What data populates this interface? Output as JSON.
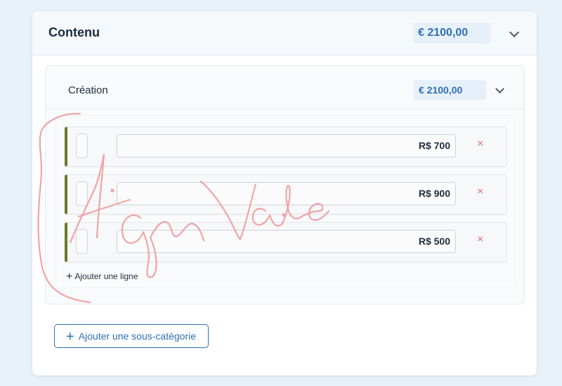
{
  "card": {
    "title": "Contenu",
    "total": "€ 2100,00",
    "chevron_icon": "chevron-down-icon"
  },
  "subcategory": {
    "title": "Création",
    "total": "€ 2100,00",
    "chevron_icon": "chevron-down-icon",
    "lines": [
      {
        "amount": "R$ 700",
        "remove_label": "×"
      },
      {
        "amount": "R$ 900",
        "remove_label": "×"
      },
      {
        "amount": "R$ 500",
        "remove_label": "×"
      }
    ],
    "add_line": {
      "icon": "plus-icon",
      "label": "Ajouter une ligne"
    }
  },
  "add_subcategory": {
    "icon": "plus-icon",
    "label": "Ajouter une sous-catégorie"
  },
  "signature": {
    "text": "Agne Vale",
    "color": "#ef9c9c"
  },
  "colors": {
    "accent": "#2f6fb3",
    "row_marker": "#6b7a2a",
    "remove": "#e36a6a",
    "badge_bg": "#e6f0fb"
  }
}
